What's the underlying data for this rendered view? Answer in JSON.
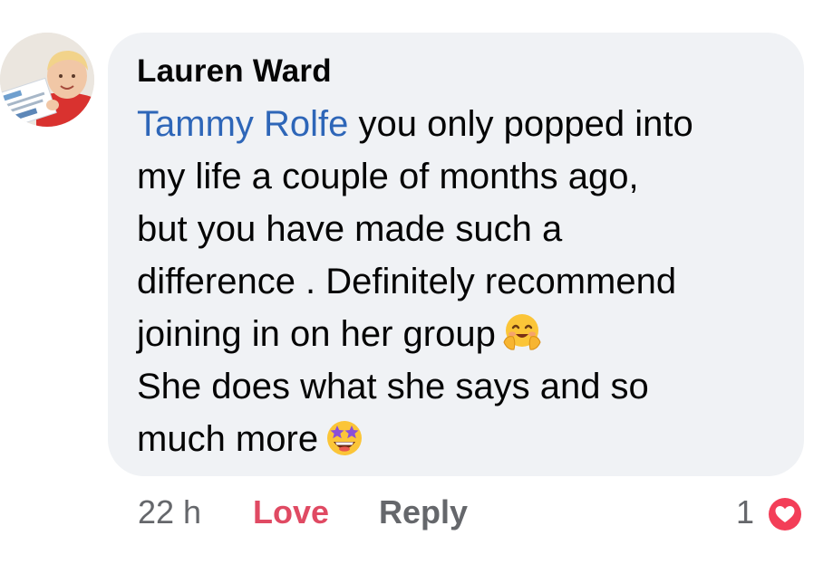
{
  "comment": {
    "author": "Lauren Ward",
    "mention": "Tammy Rolfe",
    "lines": [
      " you only popped into",
      "my life a couple of months ago,",
      "but you have made such a",
      "difference . Definitely recommend",
      "joining in on her group",
      "She does what she says and so",
      "much more"
    ],
    "emojis": [
      "smiling-face-with-open-hands",
      "star-struck"
    ]
  },
  "actions": {
    "timestamp": "22 h",
    "love_label": "Love",
    "reply_label": "Reply"
  },
  "reactions": {
    "count": "1",
    "type": "love",
    "color": "#f33e58"
  },
  "colors": {
    "bubble": "#f0f2f5",
    "mention": "#2e66b8",
    "love_text": "#e04a63",
    "meta_text": "#65676b"
  }
}
